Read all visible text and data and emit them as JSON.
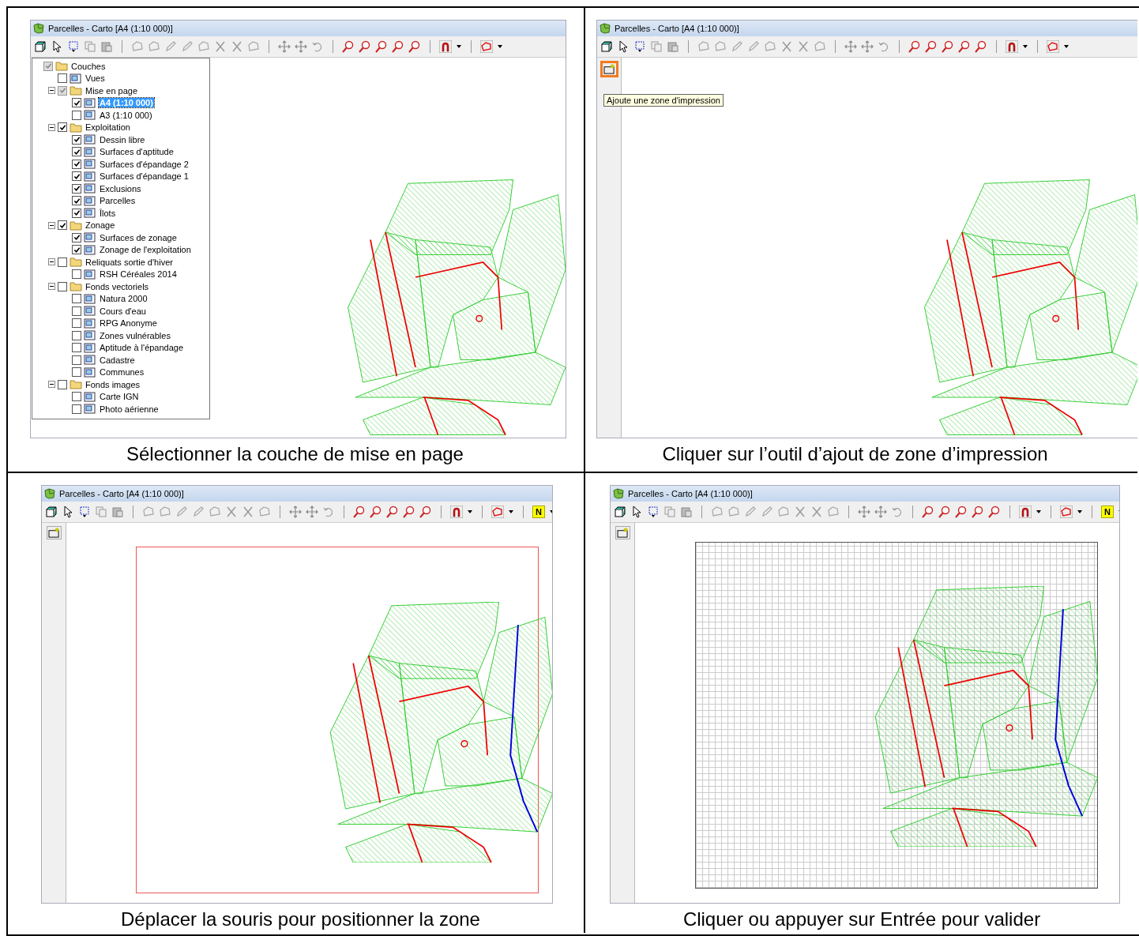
{
  "panels": [
    {
      "kind": "tree",
      "window_title": "Parcelles - Carto [A4 (1:10 000)]",
      "caption": "Sélectionner la couche de mise en page",
      "tree": [
        {
          "label": "Couches",
          "checked": true,
          "greyed": true,
          "selected": false,
          "children": [
            {
              "label": "Vues",
              "checked": false,
              "greyed": false,
              "selected": false
            },
            {
              "label": "Mise en page",
              "checked": true,
              "greyed": true,
              "selected": false,
              "children": [
                {
                  "label": "A4 (1:10 000)",
                  "checked": true,
                  "greyed": false,
                  "selected": true
                },
                {
                  "label": "A3 (1:10 000)",
                  "checked": false,
                  "greyed": false,
                  "selected": false
                }
              ]
            },
            {
              "label": "Exploitation",
              "checked": true,
              "greyed": false,
              "selected": false,
              "children": [
                {
                  "label": "Dessin libre",
                  "checked": true,
                  "greyed": false,
                  "selected": false
                },
                {
                  "label": "Surfaces d'aptitude",
                  "checked": true,
                  "greyed": false,
                  "selected": false
                },
                {
                  "label": "Surfaces d'épandage 2",
                  "checked": true,
                  "greyed": false,
                  "selected": false
                },
                {
                  "label": "Surfaces d'épandage 1",
                  "checked": true,
                  "greyed": false,
                  "selected": false
                },
                {
                  "label": "Exclusions",
                  "checked": true,
                  "greyed": false,
                  "selected": false
                },
                {
                  "label": "Parcelles",
                  "checked": true,
                  "greyed": false,
                  "selected": false
                },
                {
                  "label": "Îlots",
                  "checked": true,
                  "greyed": false,
                  "selected": false
                }
              ]
            },
            {
              "label": "Zonage",
              "checked": true,
              "greyed": false,
              "selected": false,
              "children": [
                {
                  "label": "Surfaces de zonage",
                  "checked": true,
                  "greyed": false,
                  "selected": false
                },
                {
                  "label": "Zonage de l'exploitation",
                  "checked": true,
                  "greyed": false,
                  "selected": false
                }
              ]
            },
            {
              "label": "Reliquats sortie d'hiver",
              "checked": false,
              "greyed": false,
              "selected": false,
              "children": [
                {
                  "label": "RSH Céréales 2014",
                  "checked": false,
                  "greyed": false,
                  "selected": false
                }
              ]
            },
            {
              "label": "Fonds vectoriels",
              "checked": false,
              "greyed": false,
              "selected": false,
              "children": [
                {
                  "label": "Natura 2000",
                  "checked": false,
                  "greyed": false,
                  "selected": false
                },
                {
                  "label": "Cours d'eau",
                  "checked": false,
                  "greyed": false,
                  "selected": false
                },
                {
                  "label": "RPG Anonyme",
                  "checked": false,
                  "greyed": false,
                  "selected": false
                },
                {
                  "label": "Zones vulnérables",
                  "checked": false,
                  "greyed": false,
                  "selected": false
                },
                {
                  "label": "Aptitude à l'épandage",
                  "checked": false,
                  "greyed": false,
                  "selected": false
                },
                {
                  "label": "Cadastre",
                  "checked": false,
                  "greyed": false,
                  "selected": false
                },
                {
                  "label": "Communes",
                  "checked": false,
                  "greyed": false,
                  "selected": false
                }
              ]
            },
            {
              "label": "Fonds images",
              "checked": false,
              "greyed": false,
              "selected": false,
              "children": [
                {
                  "label": "Carte IGN",
                  "checked": false,
                  "greyed": false,
                  "selected": false
                },
                {
                  "label": "Photo aérienne",
                  "checked": false,
                  "greyed": false,
                  "selected": false
                }
              ]
            }
          ]
        }
      ]
    },
    {
      "kind": "tooltip",
      "window_title": "Parcelles - Carto [A4 (1:10 000)]",
      "caption": "Cliquer sur l’outil d’ajout de zone d’impression",
      "side_tool": {
        "highlighted": true
      },
      "tooltip": "Ajoute une zone d'impression"
    },
    {
      "kind": "zone",
      "window_title": "Parcelles - Carto [A4 (1:10 000)]",
      "caption": "Déplacer la souris pour positionner la zone",
      "side_tool": {
        "highlighted": false
      },
      "north_label": "N"
    },
    {
      "kind": "grid",
      "window_title": "Parcelles - Carto [A4 (1:10 000)]",
      "caption": "Cliquer ou appuyer sur Entrée pour valider",
      "side_tool": {
        "highlighted": false
      },
      "north_label": "N"
    }
  ]
}
